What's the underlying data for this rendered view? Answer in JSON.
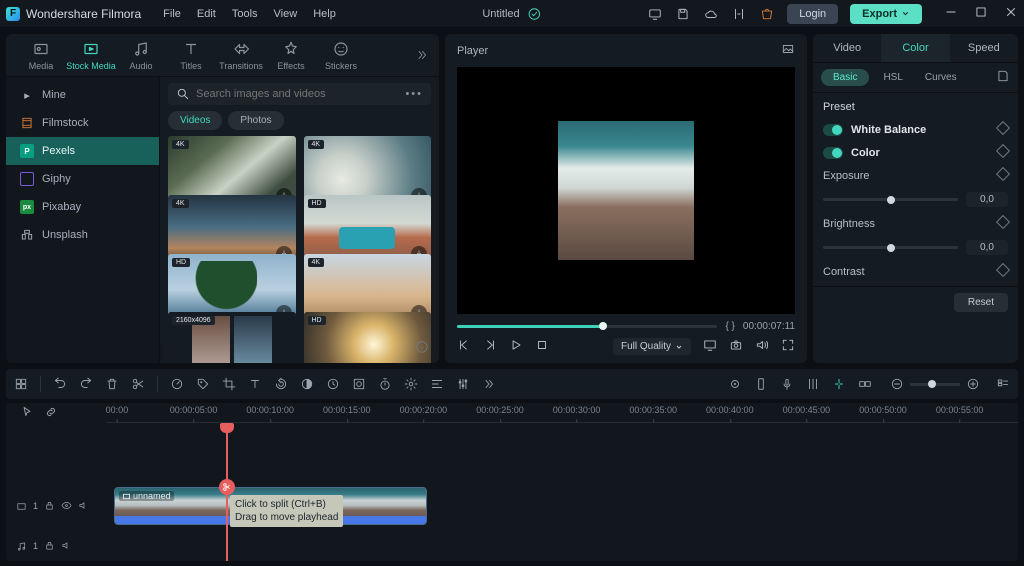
{
  "titlebar": {
    "brand": "Wondershare Filmora",
    "menus": [
      "File",
      "Edit",
      "Tools",
      "View",
      "Help"
    ],
    "project": "Untitled",
    "login": "Login",
    "export": "Export"
  },
  "mediaTabs": {
    "items": [
      {
        "label": "Media",
        "icon": "media-icon"
      },
      {
        "label": "Stock Media",
        "icon": "stock-icon",
        "active": true
      },
      {
        "label": "Audio",
        "icon": "audio-icon"
      },
      {
        "label": "Titles",
        "icon": "titles-icon"
      },
      {
        "label": "Transitions",
        "icon": "transitions-icon"
      },
      {
        "label": "Effects",
        "icon": "effects-icon"
      },
      {
        "label": "Stickers",
        "icon": "stickers-icon"
      }
    ]
  },
  "sources": [
    {
      "label": "Mine"
    },
    {
      "label": "Filmstock"
    },
    {
      "label": "Pexels",
      "active": true
    },
    {
      "label": "Giphy"
    },
    {
      "label": "Pixabay"
    },
    {
      "label": "Unsplash"
    }
  ],
  "search": {
    "placeholder": "Search images and videos"
  },
  "subfilters": [
    {
      "label": "Videos",
      "active": true
    },
    {
      "label": "Photos"
    }
  ],
  "thumbs": [
    {
      "badge": "4K",
      "bg": "bg-waterfall"
    },
    {
      "badge": "4K",
      "bg": "bg-wave1"
    },
    {
      "badge": "4K",
      "bg": "bg-lake"
    },
    {
      "badge": "HD",
      "bg": "bg-bus"
    },
    {
      "badge": "HD",
      "bg": "bg-palm"
    },
    {
      "badge": "4K",
      "bg": "bg-dunes"
    },
    {
      "badge": "2160x4096",
      "bg": "bg-vertical"
    },
    {
      "badge": "HD",
      "bg": "bg-sunset"
    }
  ],
  "player": {
    "title": "Player",
    "markers": "{    }",
    "timecode": "00:00:07:11",
    "quality": "Full Quality"
  },
  "propsPanel": {
    "tabs": [
      "Video",
      "Color",
      "Speed"
    ],
    "activeTab": "Color",
    "subTabs": {
      "basic": "Basic",
      "hsl": "HSL",
      "curves": "Curves"
    },
    "presetHdr": "Preset",
    "whiteBalance": "White Balance",
    "color": "Color",
    "exposure": {
      "label": "Exposure",
      "value": "0,0"
    },
    "brightness": {
      "label": "Brightness",
      "value": "0,0"
    },
    "contrast": {
      "label": "Contrast"
    },
    "reset": "Reset"
  },
  "rulerMarks": [
    "00:00",
    "00:00:05:00",
    "00:00:10:00",
    "00:00:15:00",
    "00:00:20:00",
    "00:00:25:00",
    "00:00:30:00",
    "00:00:35:00",
    "00:00:40:00",
    "00:00:45:00",
    "00:00:50:00",
    "00:00:55:00"
  ],
  "tooltip": {
    "line1": "Click to split (Ctrl+B)",
    "line2": "Drag to move playhead"
  },
  "trackHeads": {
    "v1": "1",
    "a1": "1"
  },
  "clip": {
    "label": "unnamed"
  }
}
